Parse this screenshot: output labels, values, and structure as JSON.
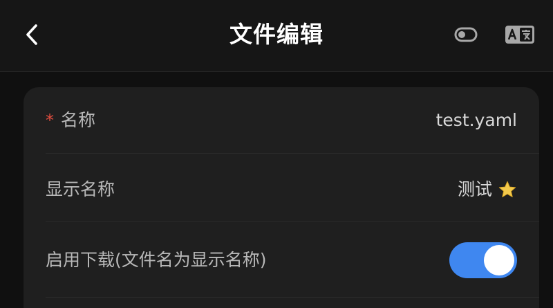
{
  "header": {
    "title": "文件编辑",
    "back_icon": "chevron-left-icon",
    "toggle_icon": "toggle-icon",
    "translate_icon": "translate-icon"
  },
  "form": {
    "name": {
      "required_mark": "*",
      "label": "名称",
      "value": "test.yaml"
    },
    "display_name": {
      "label": "显示名称",
      "value": "测试",
      "icon": "star-icon"
    },
    "enable_download": {
      "label": "启用下载(文件名为显示名称)",
      "enabled": true
    }
  },
  "colors": {
    "accent": "#3f87f0",
    "required": "#e34d3f",
    "star": "#f2c94c"
  }
}
